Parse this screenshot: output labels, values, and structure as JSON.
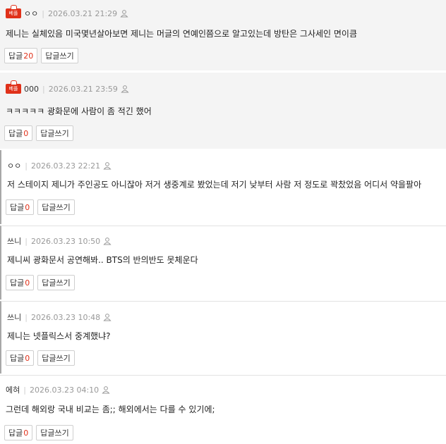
{
  "badge_label": "베플",
  "reply_label": "답글",
  "write_label": "답글쓰기",
  "comments": [
    {
      "author": "ㅇㅇ",
      "date": "2026.03.21 21:29",
      "text": "제니는 실체있음 미국몇년살아보면 제니는 머글의 연예인쯤으로 알고있는데 방탄은 그사세인 면이큼",
      "reply_count": "20"
    },
    {
      "author": "000",
      "date": "2026.03.21 23:59",
      "text": "ㅋㅋㅋㅋㅋ 광화문에 사람이 좀 적긴 했어",
      "reply_count": "0"
    },
    {
      "author": "ㅇㅇ",
      "date": "2026.03.23 22:21",
      "text": "저 스테이지 제니가 주인공도 아니잖아 저거 생중계로 봤었는데 저기 낮부터 사람 저 정도로 꽉찼었음 어디서 약을팔아",
      "reply_count": "0"
    },
    {
      "author": "쓰니",
      "date": "2026.03.23 10:50",
      "text": "제니씨 광화문서 공연해봐.. BTS의 반의반도 못체운다",
      "reply_count": "0"
    },
    {
      "author": "쓰니",
      "date": "2026.03.23 10:48",
      "text": "제니는 넷플릭스서 중계했냐?",
      "reply_count": "0"
    },
    {
      "author": "에혀",
      "date": "2026.03.23 04:10",
      "text": "그런데 해외랑 국내 비교는 좀;; 해외에서는 다를 수 있기에;",
      "reply_count": "0"
    }
  ],
  "colors": {
    "accent": "#e0311a",
    "best_bg": "#f4f4f4"
  }
}
